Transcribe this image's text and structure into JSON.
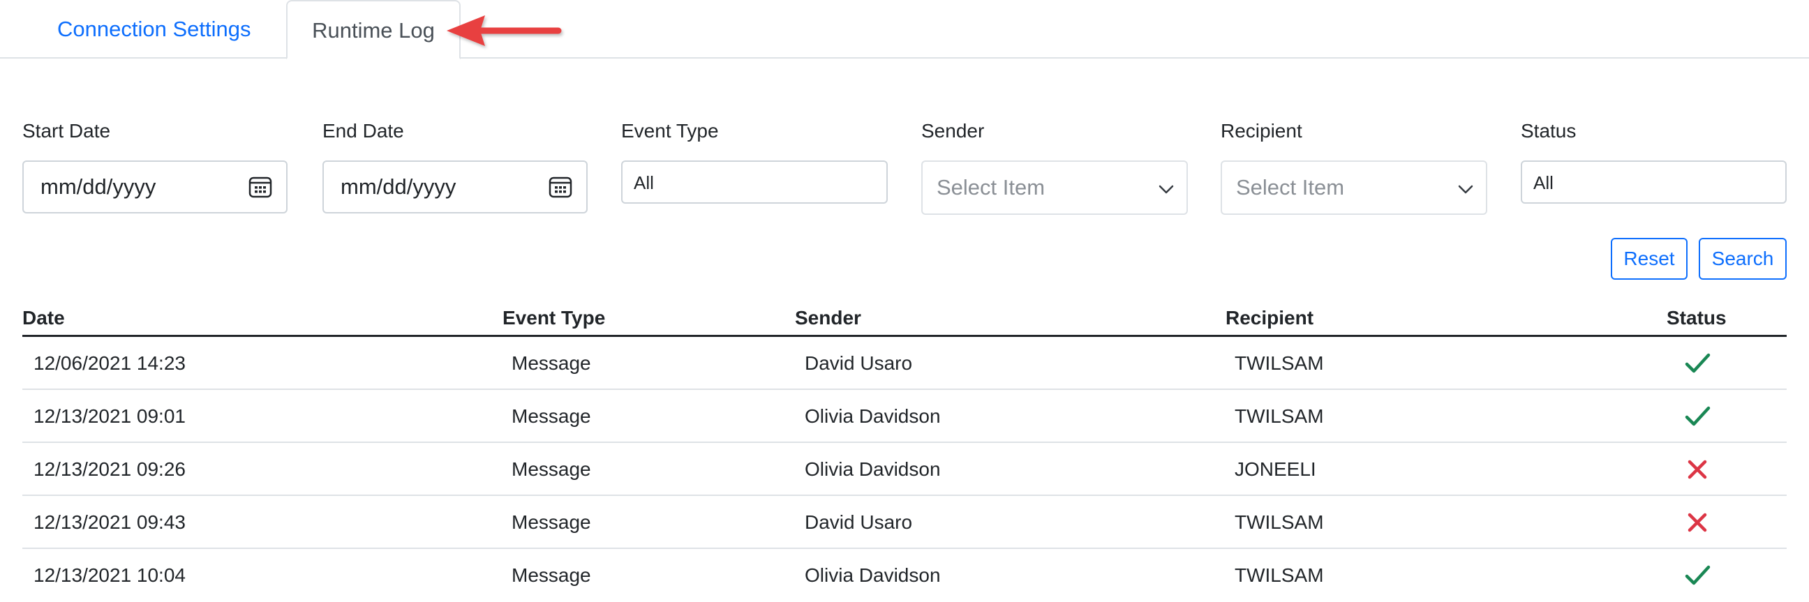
{
  "tabs": {
    "connection_settings": "Connection Settings",
    "runtime_log": "Runtime Log"
  },
  "filters": {
    "start_date": {
      "label": "Start Date",
      "placeholder": "mm/dd/yyyy"
    },
    "end_date": {
      "label": "End Date",
      "placeholder": "mm/dd/yyyy"
    },
    "event_type": {
      "label": "Event Type",
      "value": "All"
    },
    "sender": {
      "label": "Sender",
      "placeholder": "Select Item"
    },
    "recipient": {
      "label": "Recipient",
      "placeholder": "Select Item"
    },
    "status": {
      "label": "Status",
      "value": "All"
    }
  },
  "buttons": {
    "reset": "Reset",
    "search": "Search"
  },
  "table": {
    "headers": {
      "date": "Date",
      "event_type": "Event Type",
      "sender": "Sender",
      "recipient": "Recipient",
      "status": "Status"
    },
    "rows": [
      {
        "date": "12/06/2021 14:23",
        "event_type": "Message",
        "sender": "David Usaro",
        "recipient": "TWILSAM",
        "status": "success"
      },
      {
        "date": "12/13/2021 09:01",
        "event_type": "Message",
        "sender": "Olivia Davidson",
        "recipient": "TWILSAM",
        "status": "success"
      },
      {
        "date": "12/13/2021 09:26",
        "event_type": "Message",
        "sender": "Olivia Davidson",
        "recipient": "JONEELI",
        "status": "failure"
      },
      {
        "date": "12/13/2021 09:43",
        "event_type": "Message",
        "sender": "David Usaro",
        "recipient": "TWILSAM",
        "status": "failure"
      },
      {
        "date": "12/13/2021 10:04",
        "event_type": "Message",
        "sender": "Olivia Davidson",
        "recipient": "TWILSAM",
        "status": "success"
      }
    ]
  },
  "colors": {
    "accent": "#0d6efd",
    "success": "#198754",
    "failure": "#dc3545",
    "annotation_arrow": "#e8403f"
  },
  "icons": {
    "success": "checkmark-icon",
    "failure": "x-mark-icon",
    "date": "calendar-icon",
    "select": "chevron-down-icon"
  }
}
